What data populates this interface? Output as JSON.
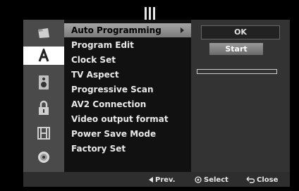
{
  "menu": {
    "items": [
      {
        "label": "Auto Programming",
        "selected": true
      },
      {
        "label": "Program Edit",
        "selected": false
      },
      {
        "label": "Clock Set",
        "selected": false
      },
      {
        "label": "TV Aspect",
        "selected": false
      },
      {
        "label": "Progressive Scan",
        "selected": false
      },
      {
        "label": "AV2 Connection",
        "selected": false
      },
      {
        "label": "Video output format",
        "selected": false
      },
      {
        "label": "Power Save Mode",
        "selected": false
      },
      {
        "label": "Factory Set",
        "selected": false
      }
    ]
  },
  "icons": [
    {
      "name": "film-folder-icon",
      "active": false
    },
    {
      "name": "letter-a-icon",
      "active": true
    },
    {
      "name": "speaker-icon",
      "active": false
    },
    {
      "name": "lock-icon",
      "active": false
    },
    {
      "name": "film-frame-icon",
      "active": false
    },
    {
      "name": "disc-icon",
      "active": false
    }
  ],
  "panel": {
    "ok_label": "OK",
    "start_label": "Start",
    "progress": 0
  },
  "footer": {
    "prev_label": "Prev.",
    "select_label": "Select",
    "close_label": "Close"
  },
  "colors": {
    "frame": "#3c3c3c",
    "selected_item": "#9a9a9a",
    "active_icon_bg": "#ffffff"
  }
}
